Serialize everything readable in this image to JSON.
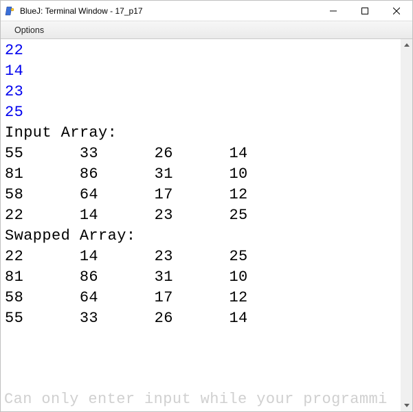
{
  "window": {
    "title": "BlueJ: Terminal Window - 17_p17"
  },
  "menu": {
    "options": "Options"
  },
  "terminal": {
    "user_inputs": [
      "22",
      "14",
      "23",
      "25"
    ],
    "label_input": "Input Array:",
    "input_array": [
      [
        "55",
        "33",
        "26",
        "14"
      ],
      [
        "81",
        "86",
        "31",
        "10"
      ],
      [
        "58",
        "64",
        "17",
        "12"
      ],
      [
        "22",
        "14",
        "23",
        "25"
      ]
    ],
    "label_swapped": "Swapped Array:",
    "swapped_array": [
      [
        "22",
        "14",
        "23",
        "25"
      ],
      [
        "81",
        "86",
        "31",
        "10"
      ],
      [
        "58",
        "64",
        "17",
        "12"
      ],
      [
        "55",
        "33",
        "26",
        "14"
      ]
    ],
    "status": "Can only enter input while your programmi"
  }
}
